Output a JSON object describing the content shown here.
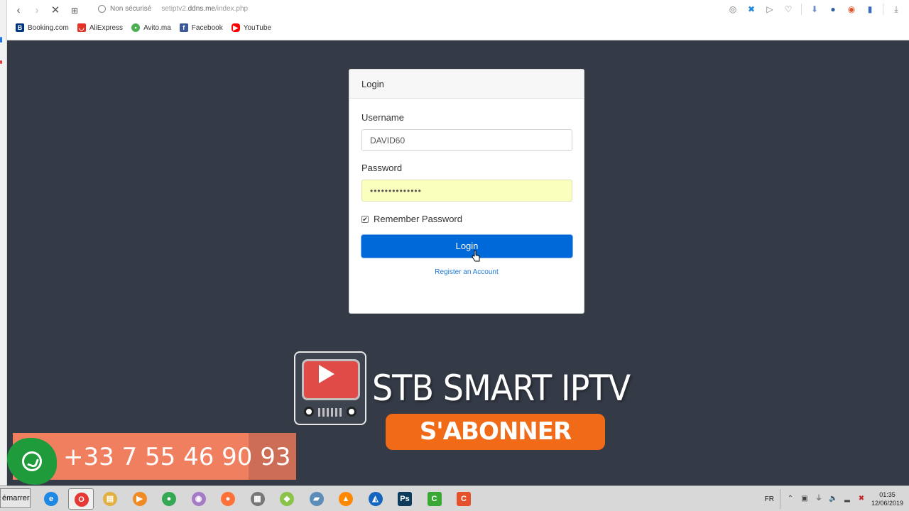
{
  "browser": {
    "security_label": "Non sécurisé",
    "url_prefix": "setiptv2.",
    "url_domain": "ddns.me",
    "url_path": "/index.php",
    "bookmarks": [
      {
        "label": "Booking.com",
        "icon": "booking-icon",
        "color": "#003580"
      },
      {
        "label": "AliExpress",
        "icon": "aliexpress-icon",
        "color": "#e43225"
      },
      {
        "label": "Avito.ma",
        "icon": "avito-icon",
        "color": "#4caf50"
      },
      {
        "label": "Facebook",
        "icon": "facebook-icon",
        "color": "#3b5998"
      },
      {
        "label": "YouTube",
        "icon": "youtube-icon",
        "color": "#ff0000"
      }
    ]
  },
  "login": {
    "header": "Login",
    "username_label": "Username",
    "username_value": "DAVID60",
    "password_label": "Password",
    "password_value": "••••••••••••••",
    "remember_label": "Remember Password",
    "remember_checked": true,
    "submit_label": "Login",
    "register_link": "Register an Account",
    "button_color": "#0069d9",
    "autofill_color": "#faffbd"
  },
  "overlay": {
    "brand": "STB SMART IPTV",
    "subscribe": "S'ABONNER",
    "phone": "+33 7 55 46 90 93",
    "phone_banner_color": "#f07f60",
    "subscribe_color": "#f06a17"
  },
  "taskbar": {
    "start_label": "émarrer",
    "language": "FR",
    "time": "01:35",
    "date": "12/06/2019",
    "apps": [
      {
        "icon": "internet-explorer-icon",
        "color": "#1e88e5",
        "glyph": "e"
      },
      {
        "icon": "opera-icon",
        "color": "#e53935",
        "glyph": "O"
      },
      {
        "icon": "file-explorer-icon",
        "color": "#e0b040",
        "glyph": "▤"
      },
      {
        "icon": "media-player-icon",
        "color": "#f08a24",
        "glyph": "▶"
      },
      {
        "icon": "chrome-icon",
        "color": "#34a853",
        "glyph": "●"
      },
      {
        "icon": "tor-browser-icon",
        "color": "#a67bc6",
        "glyph": "◉"
      },
      {
        "icon": "firefox-icon",
        "color": "#ff7139",
        "glyph": "●"
      },
      {
        "icon": "notepad-icon",
        "color": "#777777",
        "glyph": "▦"
      },
      {
        "icon": "photo-viewer-icon",
        "color": "#8bc34a",
        "glyph": "◆"
      },
      {
        "icon": "notebook-icon",
        "color": "#5c8db8",
        "glyph": "▰"
      },
      {
        "icon": "vlc-icon",
        "color": "#ff8800",
        "glyph": "▲"
      },
      {
        "icon": "anydesk-icon",
        "color": "#1565c0",
        "glyph": "◭"
      },
      {
        "icon": "photoshop-icon",
        "color": "#0d3b5c",
        "glyph": "Ps"
      },
      {
        "icon": "camtasia-green-icon",
        "color": "#3aa835",
        "glyph": "C"
      },
      {
        "icon": "camtasia-orange-icon",
        "color": "#e5512b",
        "glyph": "C"
      }
    ]
  }
}
